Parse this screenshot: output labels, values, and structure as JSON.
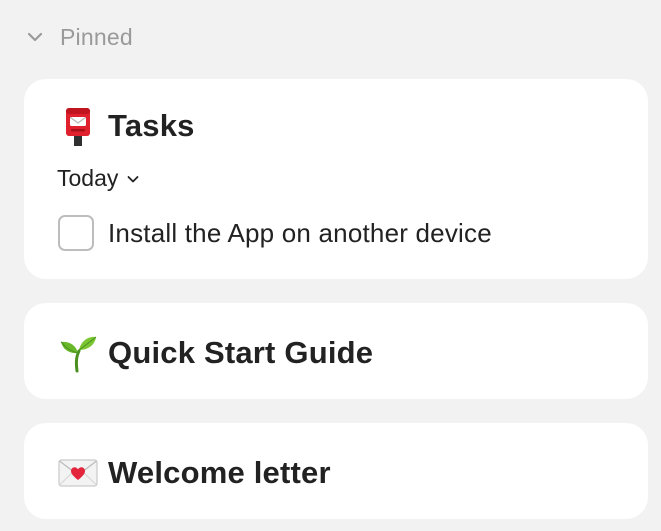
{
  "pinned": {
    "title": "Pinned",
    "chevron_icon": "chevron-down-icon"
  },
  "tasks_card": {
    "emoji_icon": "postbox-icon",
    "title": "Tasks",
    "filter_label": "Today",
    "filter_icon": "chevron-down-icon",
    "items": [
      {
        "label": "Install the App on another device",
        "checked": false
      }
    ]
  },
  "guide_card": {
    "emoji_icon": "seedling-icon",
    "title": "Quick Start Guide"
  },
  "letter_card": {
    "emoji_icon": "love-letter-icon",
    "title": "Welcome letter"
  },
  "colors": {
    "background": "#f2f2f2",
    "card": "#ffffff",
    "muted_text": "#9a9a9a",
    "text": "#222222"
  }
}
